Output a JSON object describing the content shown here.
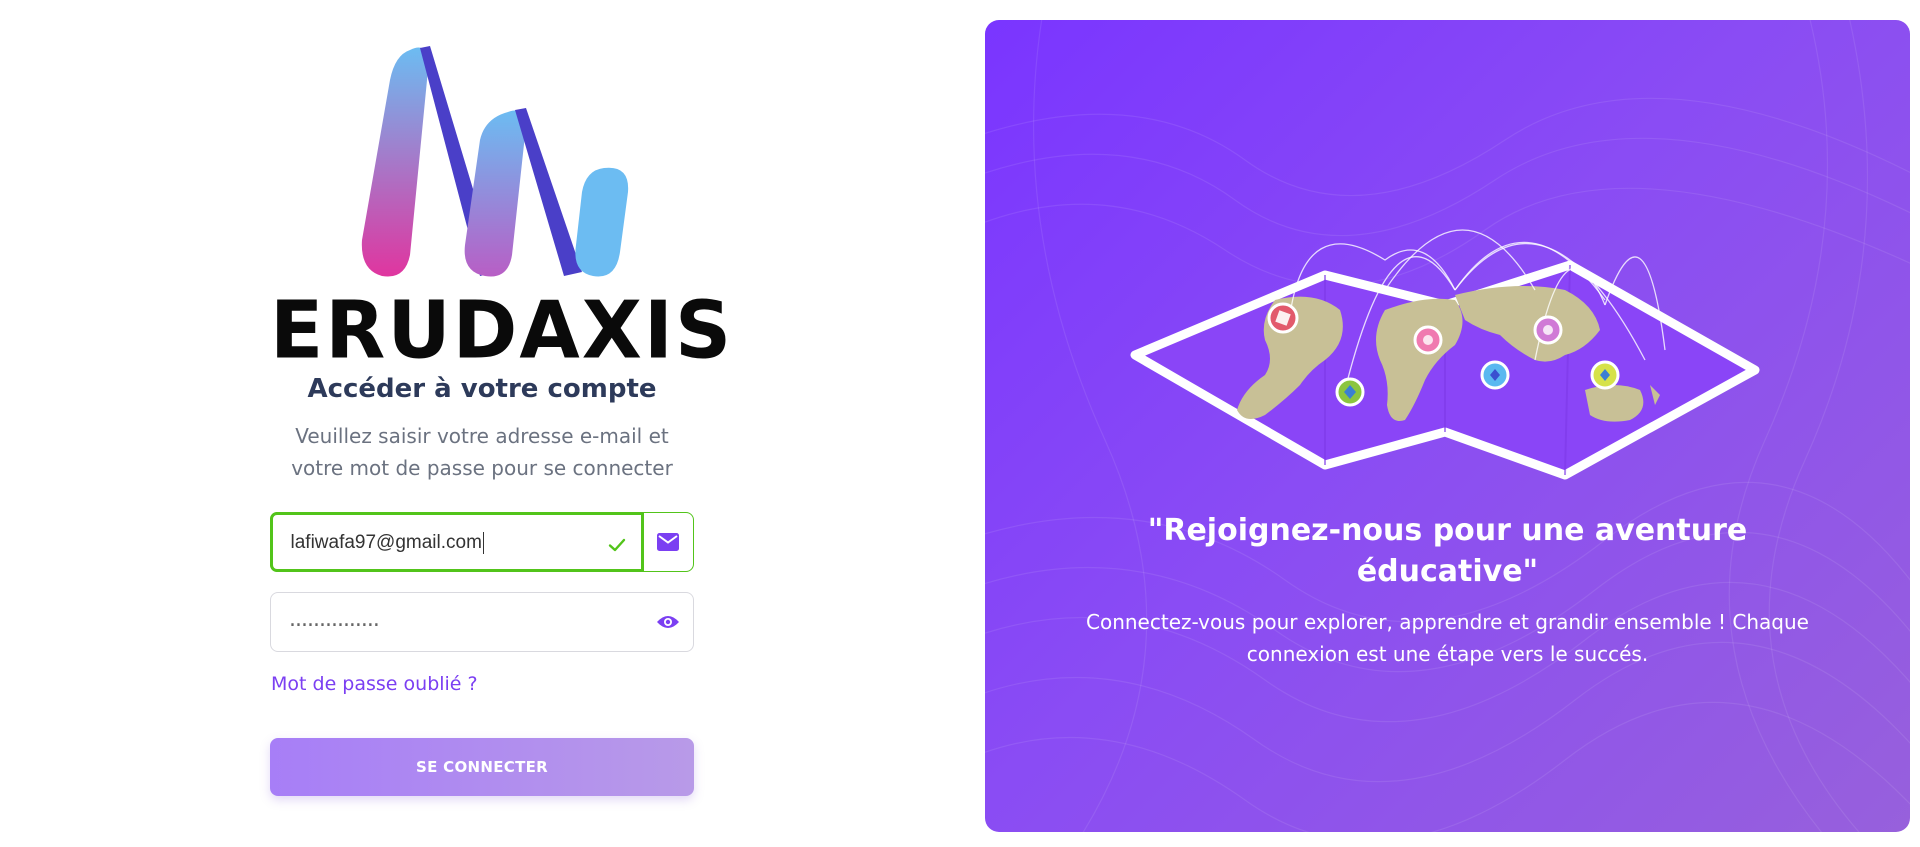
{
  "brand": {
    "name": "ERUDAXIS"
  },
  "login": {
    "title": "Accéder à votre compte",
    "subtitle": "Veuillez saisir votre adresse e-mail et votre mot de passe pour se connecter",
    "email_value": "lafiwafa97@gmail.com",
    "password_mask": "...............",
    "forgot_password": "Mot de passe oublié ?",
    "submit_label": "SE CONNECTER",
    "icons": {
      "email_valid": "check-icon",
      "email": "mail-icon",
      "password_toggle": "eye-icon"
    }
  },
  "promo": {
    "quote": "\"Rejoignez-nous pour une aventure éducative\"",
    "text": "Connectez-vous pour explorer, apprendre et grandir ensemble ! Chaque connexion est une étape vers le succés."
  },
  "colors": {
    "accent": "#7b3ff2",
    "valid": "#52c41a",
    "panel_start": "#7a35ff",
    "panel_end": "#9760dc",
    "button_start": "#a77ef7",
    "button_end": "#b89ae8"
  }
}
